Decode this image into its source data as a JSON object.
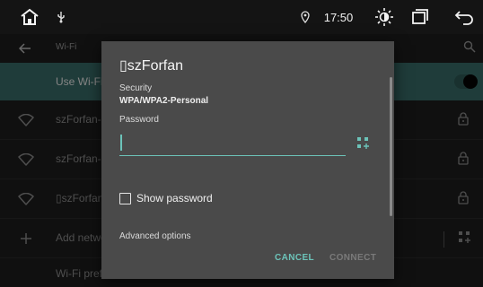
{
  "status_bar": {
    "time": "17:50",
    "icons": [
      "home-icon",
      "usb-icon",
      "location-icon",
      "brightness-icon",
      "recent-apps-icon",
      "back-icon"
    ]
  },
  "settings": {
    "header_title": "Wi-Fi",
    "use_wifi_label": "Use Wi-Fi",
    "use_wifi_enabled": true,
    "networks": [
      {
        "label": "szForfan-",
        "locked": true
      },
      {
        "label": "szForfan-",
        "locked": true
      },
      {
        "label": "▯szForfan",
        "locked": true
      }
    ],
    "add_network_label": "Add network",
    "preferences_label": "Wi-Fi preferences"
  },
  "dialog": {
    "title": "▯szForfan",
    "security_label": "Security",
    "security_value": "WPA/WPA2-Personal",
    "password_label": "Password",
    "password_value": "",
    "show_password_label": "Show password",
    "show_password_checked": false,
    "advanced_label": "Advanced options",
    "cancel_label": "CANCEL",
    "connect_label": "CONNECT",
    "connect_enabled": false
  },
  "colors": {
    "accent": "#6cc3b9",
    "highlight_row": "#3a6e6a",
    "dialog_bg": "#4a4a4a"
  }
}
